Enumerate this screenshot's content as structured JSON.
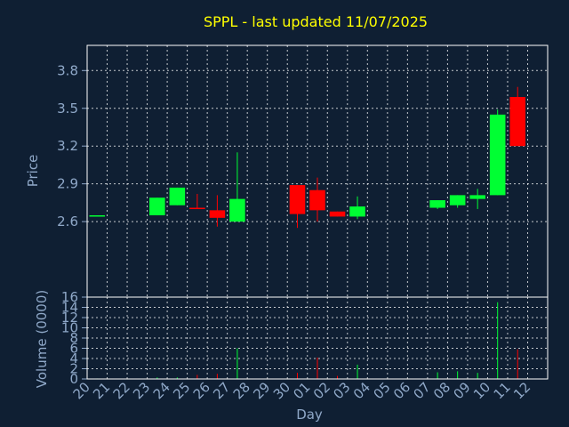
{
  "title": "SPPL - last updated 11/07/2025",
  "colors": {
    "background": "#0f1f33",
    "title": "#ffff00",
    "axis_text": "#8fa8c8",
    "frame": "#ffffff",
    "grid": "#ffffff",
    "up": "#00ff33",
    "down": "#ff0000",
    "price_line": "#00ff33"
  },
  "chart_data": [
    {
      "type": "candlestick",
      "ylabel": "Price",
      "ylim": [
        2.0,
        4.0
      ],
      "yticks": [
        "2.6",
        "2.9",
        "3.2",
        "3.5",
        "3.8"
      ],
      "grid": true,
      "x": [
        "20",
        "21",
        "22",
        "23",
        "24",
        "25",
        "26",
        "27",
        "28",
        "29",
        "30",
        "01",
        "02",
        "03",
        "04",
        "05",
        "06",
        "07",
        "08",
        "09",
        "10",
        "11",
        "12"
      ],
      "candles": [
        {
          "x": "20",
          "open": 2.65,
          "close": 2.65,
          "high": 2.65,
          "low": 2.65
        },
        {
          "x": "23",
          "open": 2.65,
          "close": 2.79,
          "high": 2.79,
          "low": 2.65
        },
        {
          "x": "24",
          "open": 2.73,
          "close": 2.87,
          "high": 2.87,
          "low": 2.73
        },
        {
          "x": "25",
          "open": 2.71,
          "close": 2.7,
          "high": 2.82,
          "low": 2.7
        },
        {
          "x": "26",
          "open": 2.69,
          "close": 2.63,
          "high": 2.81,
          "low": 2.56
        },
        {
          "x": "27",
          "open": 2.6,
          "close": 2.78,
          "high": 3.15,
          "low": 2.6
        },
        {
          "x": "30",
          "open": 2.89,
          "close": 2.66,
          "high": 2.89,
          "low": 2.55
        },
        {
          "x": "01",
          "open": 2.85,
          "close": 2.69,
          "high": 2.95,
          "low": 2.6
        },
        {
          "x": "02",
          "open": 2.68,
          "close": 2.64,
          "high": 2.68,
          "low": 2.64
        },
        {
          "x": "03",
          "open": 2.64,
          "close": 2.72,
          "high": 2.8,
          "low": 2.62
        },
        {
          "x": "07",
          "open": 2.71,
          "close": 2.77,
          "high": 2.77,
          "low": 2.7
        },
        {
          "x": "08",
          "open": 2.73,
          "close": 2.81,
          "high": 2.81,
          "low": 2.71
        },
        {
          "x": "09",
          "open": 2.78,
          "close": 2.81,
          "high": 2.86,
          "low": 2.7
        },
        {
          "x": "10",
          "open": 2.81,
          "close": 3.45,
          "high": 3.49,
          "low": 2.81
        },
        {
          "x": "11",
          "open": 3.59,
          "close": 3.2,
          "high": 3.67,
          "low": 3.2
        }
      ]
    },
    {
      "type": "bar",
      "ylabel": "Volume (0000)",
      "xlabel": "Day",
      "ylim": [
        0,
        16
      ],
      "yticks": [
        "0",
        "2",
        "4",
        "6",
        "8",
        "10",
        "12",
        "14",
        "16"
      ],
      "grid": true,
      "categories": [
        "20",
        "21",
        "22",
        "23",
        "24",
        "25",
        "26",
        "27",
        "28",
        "29",
        "30",
        "01",
        "02",
        "03",
        "04",
        "05",
        "06",
        "07",
        "08",
        "09",
        "10",
        "11",
        "12"
      ],
      "bars": [
        {
          "x": "20",
          "value": 0.1,
          "dir": "up"
        },
        {
          "x": "23",
          "value": 0.3,
          "dir": "up"
        },
        {
          "x": "24",
          "value": 0.3,
          "dir": "up"
        },
        {
          "x": "25",
          "value": 0.8,
          "dir": "down"
        },
        {
          "x": "26",
          "value": 1.0,
          "dir": "down"
        },
        {
          "x": "27",
          "value": 6.0,
          "dir": "up"
        },
        {
          "x": "30",
          "value": 1.2,
          "dir": "down"
        },
        {
          "x": "01",
          "value": 4.2,
          "dir": "down"
        },
        {
          "x": "02",
          "value": 0.6,
          "dir": "down"
        },
        {
          "x": "03",
          "value": 2.8,
          "dir": "up"
        },
        {
          "x": "07",
          "value": 1.3,
          "dir": "up"
        },
        {
          "x": "08",
          "value": 1.5,
          "dir": "up"
        },
        {
          "x": "09",
          "value": 1.2,
          "dir": "up"
        },
        {
          "x": "10",
          "value": 15.0,
          "dir": "up"
        },
        {
          "x": "11",
          "value": 5.8,
          "dir": "down"
        }
      ]
    }
  ]
}
